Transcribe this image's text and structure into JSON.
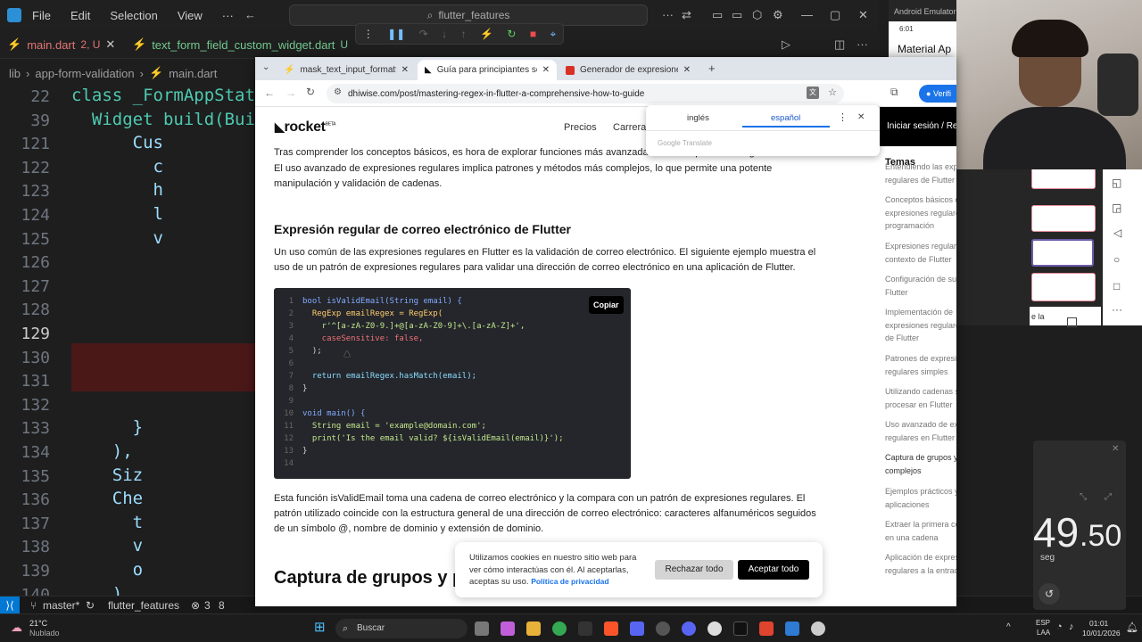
{
  "vscode": {
    "menus": [
      "File",
      "Edit",
      "Selection",
      "View"
    ],
    "search": "flutter_features",
    "tabs": [
      {
        "label": "main.dart",
        "badge": "2, U"
      },
      {
        "label": "text_form_field_custom_widget.dart",
        "badge": "U"
      }
    ],
    "breadcrumbs": [
      "lib",
      "app-form-validation",
      "main.dart"
    ],
    "lines": [
      {
        "n": "22",
        "code": "class _FormAppState"
      },
      {
        "n": "39",
        "code": "  Widget build(Bui"
      },
      {
        "n": "121",
        "code": "      Cus"
      },
      {
        "n": "122",
        "code": "        c"
      },
      {
        "n": "123",
        "code": "        h"
      },
      {
        "n": "124",
        "code": "        l"
      },
      {
        "n": "125",
        "code": "        v"
      },
      {
        "n": "126",
        "code": ""
      },
      {
        "n": "127",
        "code": ""
      },
      {
        "n": "128",
        "code": ""
      },
      {
        "n": "129",
        "code": ""
      },
      {
        "n": "130",
        "code": ""
      },
      {
        "n": "131",
        "code": ""
      },
      {
        "n": "132",
        "code": ""
      },
      {
        "n": "133",
        "code": "      }"
      },
      {
        "n": "134",
        "code": "    ),"
      },
      {
        "n": "135",
        "code": "    Siz"
      },
      {
        "n": "136",
        "code": "    Che"
      },
      {
        "n": "137",
        "code": "      t"
      },
      {
        "n": "138",
        "code": "      v"
      },
      {
        "n": "139",
        "code": "      o"
      },
      {
        "n": "140",
        "code": "    ),"
      }
    ],
    "status": {
      "branch": "master*",
      "project": "flutter_features",
      "problems": "3",
      "warnings": "8"
    }
  },
  "chrome": {
    "tabs": [
      {
        "label": "mask_text_input_formatter | Flu"
      },
      {
        "label": "Guía para principiantes sobre l"
      },
      {
        "label": "Generador de expresiones regu"
      }
    ],
    "url": "dhiwise.com/post/mastering-regex-in-flutter-a-comprehensive-how-to-guide",
    "verify": "Verifi"
  },
  "translate": {
    "lang1": "inglés",
    "lang2": "español",
    "brand": "Google Translate"
  },
  "site": {
    "logo": "rocket",
    "logo_badge": "BETA",
    "nav": [
      "Precios",
      "Carreras"
    ],
    "signin": "Iniciar sesión / Re",
    "intro1": "Tras comprender los conceptos básicos, es hora de explorar funciones más avanzadas de las expresiones regulares.",
    "intro2": "El uso avanzado de expresiones regulares implica patrones y métodos más complejos, lo que permite una potente",
    "intro3": "manipulación y validación de cadenas.",
    "heading1": "Expresión regular de correo electrónico de Flutter",
    "p1a": "Un uso común de las expresiones regulares en Flutter es la validación de correo electrónico. El siguiente ejemplo muestra el",
    "p1b": "uso de un patrón de expresiones regulares para validar una dirección de correo electrónico en una aplicación de Flutter.",
    "copy": "Copiar",
    "p2a": "Esta función isValidEmail toma una cadena de correo electrónico y la compara con un patrón de expresiones regulares. El",
    "p2b": "patrón utilizado coincide con la estructura general de una dirección de correo electrónico: caracteres alfanuméricos seguidos",
    "p2c": "de un símbolo @, nombre de dominio y extensión de dominio.",
    "heading2": "Captura de grupos y p"
  },
  "code": [
    {
      "n": "1",
      "t": "bool isValidEmail(String email) {"
    },
    {
      "n": "2",
      "t": "  RegExp emailRegex = RegExp("
    },
    {
      "n": "3",
      "t": "    r'^[a-zA-Z0-9.]+@[a-zA-Z0-9]+\\.[a-zA-Z]+',"
    },
    {
      "n": "4",
      "t": "    caseSensitive: false,"
    },
    {
      "n": "5",
      "t": "  );"
    },
    {
      "n": "6",
      "t": ""
    },
    {
      "n": "7",
      "t": "  return emailRegex.hasMatch(email);"
    },
    {
      "n": "8",
      "t": "}"
    },
    {
      "n": "9",
      "t": ""
    },
    {
      "n": "10",
      "t": "void main() {"
    },
    {
      "n": "11",
      "t": "  String email = 'example@domain.com';"
    },
    {
      "n": "12",
      "t": "  print('Is the email valid? ${isValidEmail(email)}');"
    },
    {
      "n": "13",
      "t": "}"
    },
    {
      "n": "14",
      "t": ""
    }
  ],
  "toc": {
    "title": "Temas",
    "items": [
      "Entendiendo las expresiones regulares de Flutter",
      "Conceptos básicos de expresiones regulares en programación",
      "Expresiones regulares en el contexto de Flutter",
      "Configuración de su entorno Flutter",
      "Implementación de expresiones regulares básicas de Flutter",
      "Patrones de expresiones regulares simples",
      "Utilizando cadenas sin procesar en Flutter",
      "Uso avanzado de expresiones regulares en Flutter",
      "Captura de grupos y patrones complejos",
      "Ejemplos prácticos y aplicaciones",
      "Extraer la primera coincidencia en una cadena",
      "Aplicación de expresiones regulares a la entrada del"
    ]
  },
  "cookie": {
    "text1": "Utilizamos cookies en nuestro sitio web para",
    "text2": "ver cómo interactúas con él. Al aceptarlas,",
    "text3": "aceptas su uso.",
    "link": "Política de privacidad",
    "reject": "Rechazar todo",
    "accept": "Aceptar todo"
  },
  "emulator": {
    "title": "Android Emulator -",
    "time": "6:01",
    "app_title": "Material Ap",
    "checkbox_label": "e la"
  },
  "stopwatch": {
    "value": "49",
    "fraction": ".50",
    "unit": "seg"
  },
  "taskbar": {
    "weather_temp": "21°C",
    "weather_text": "Nublado",
    "search": "Buscar",
    "lang": "ESP",
    "lang2": "LAA",
    "time": "01:01",
    "date": "10/01/2026"
  }
}
